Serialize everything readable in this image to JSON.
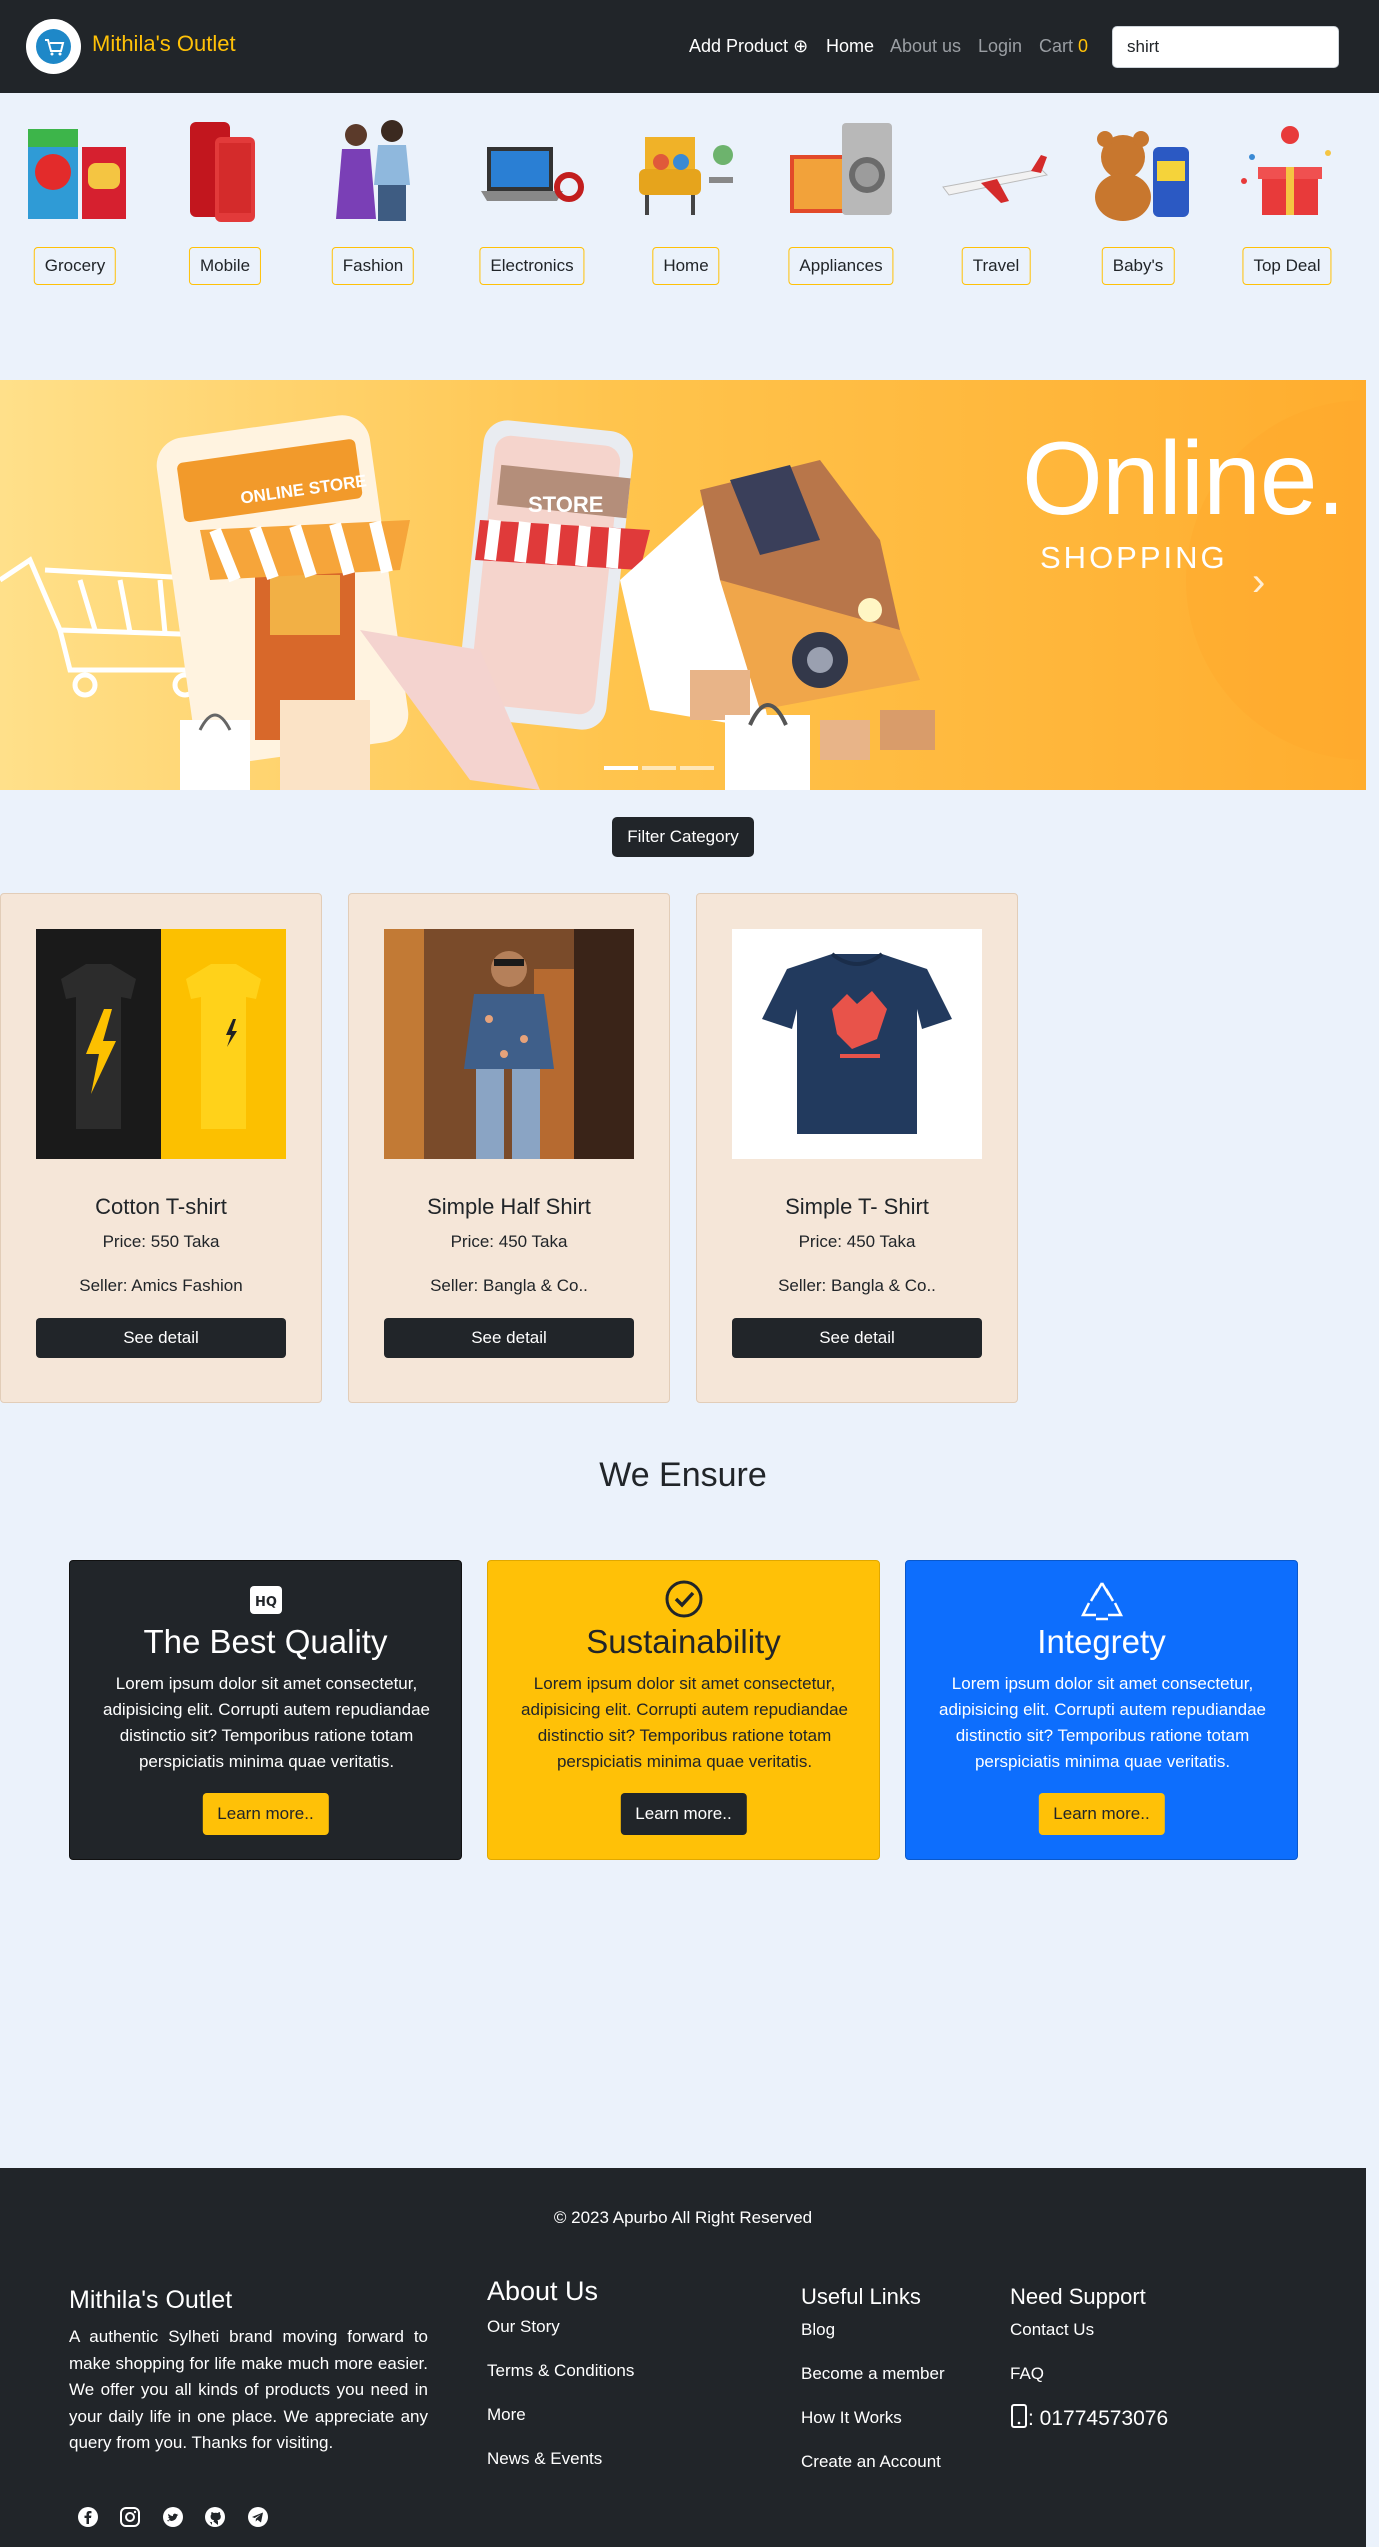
{
  "navbar": {
    "brand": "Mithila's Outlet",
    "add_product": "Add Product ⊕",
    "home": "Home",
    "about": "About us",
    "login": "Login",
    "cart_label": "Cart",
    "cart_count": "0",
    "search_value": "shirt"
  },
  "categories": [
    "Grocery",
    "Mobile",
    "Fashion",
    "Electronics",
    "Home",
    "Appliances",
    "Travel",
    "Baby's",
    "Top Deal"
  ],
  "banner": {
    "title": "Online.",
    "subtitle": "SHOPPING",
    "store_sign": "ONLINE STORE",
    "phone_sign": "STORE",
    "next": "›"
  },
  "filter_label": "Filter Category",
  "products": [
    {
      "title": "Cotton T-shirt",
      "price": "Price: 550 Taka",
      "seller": "Seller: Amics Fashion",
      "button": "See detail"
    },
    {
      "title": "Simple Half Shirt",
      "price": "Price: 450 Taka",
      "seller": "Seller: Bangla & Co..",
      "button": "See detail"
    },
    {
      "title": "Simple T- Shirt",
      "price": "Price: 450 Taka",
      "seller": "Seller: Bangla & Co..",
      "button": "See detail"
    }
  ],
  "ensure": {
    "heading": "We Ensure",
    "cards": [
      {
        "title": "The Best Quality",
        "text": "Lorem ipsum dolor sit amet consectetur, adipisicing elit. Corrupti autem repudiandae distinctio sit? Temporibus ratione totam perspiciatis minima quae veritatis.",
        "button": "Learn more..",
        "badge": "HQ"
      },
      {
        "title": "Sustainability",
        "text": "Lorem ipsum dolor sit amet consectetur, adipisicing elit. Corrupti autem repudiandae distinctio sit? Temporibus ratione totam perspiciatis minima quae veritatis.",
        "button": "Learn more.."
      },
      {
        "title": "Integrety",
        "text": "Lorem ipsum dolor sit amet consectetur, adipisicing elit. Corrupti autem repudiandae distinctio sit? Temporibus ratione totam perspiciatis minima quae veritatis.",
        "button": "Learn more.."
      }
    ]
  },
  "footer": {
    "copyright": "© 2023 Apurbo All Right Reserved",
    "brand": "Mithila's Outlet",
    "description": "A authentic Sylheti brand moving forward to make shopping for life make much more easier. We offer you all kinds of products you need in your daily life in one place. We appreciate any query from you. Thanks for visiting.",
    "about_title": "About Us",
    "about_links": [
      "Our Story",
      "Terms & Conditions",
      "More",
      "News & Events"
    ],
    "useful_title": "Useful Links",
    "useful_links": [
      "Blog",
      "Become a member",
      "How It Works",
      "Create an Account"
    ],
    "support_title": "Need Support",
    "support_links": [
      "Contact Us",
      "FAQ"
    ],
    "phone": ": 01774573076"
  },
  "colors": {
    "dark": "#212529",
    "accent": "#ffc107",
    "blue": "#0d6efd",
    "page_bg": "#ebf2fb",
    "card_bg": "#f5e6d8"
  },
  "icons": [
    "cart-logo-icon",
    "plus-circle-icon",
    "check-circle-icon",
    "recycle-icon",
    "hq-icon",
    "chevron-right-icon",
    "phone-icon",
    "facebook-icon",
    "instagram-icon",
    "twitter-icon",
    "github-icon",
    "telegram-icon"
  ]
}
